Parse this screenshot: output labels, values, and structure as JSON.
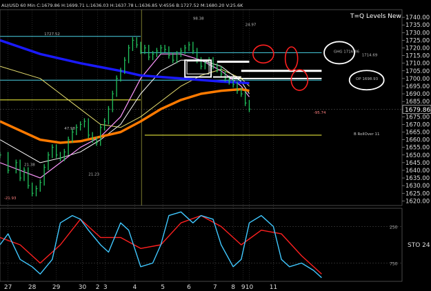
{
  "header": "AU/USD 60 Min  C:1679.86  H:1699.71  L:1636.03  H:1637.78  L:1636.85  V:4556  B:1727.52  M:1680.20  V:25.6K",
  "chart_data": {
    "type": "line",
    "title": "T=Q Levels New",
    "instrument": "AU/USD 60 Min",
    "ylim": [
      1617,
      1745
    ],
    "y_ticks": [
      1620,
      1625,
      1630,
      1635,
      1640,
      1645,
      1650,
      1655,
      1660,
      1665,
      1670,
      1675,
      1680,
      1685,
      1690,
      1695,
      1700,
      1705,
      1710,
      1715,
      1720,
      1725,
      1730,
      1735,
      1740
    ],
    "x_ticks": [
      {
        "label": "27",
        "pos": 0.02
      },
      {
        "label": "28",
        "pos": 0.08
      },
      {
        "label": "29",
        "pos": 0.14
      },
      {
        "label": "30",
        "pos": 0.205
      },
      {
        "label": "2",
        "pos": 0.243
      },
      {
        "label": "3",
        "pos": 0.262
      },
      {
        "label": "4",
        "pos": 0.335
      },
      {
        "label": "5",
        "pos": 0.405
      },
      {
        "label": "6",
        "pos": 0.47
      },
      {
        "label": "7",
        "pos": 0.535
      },
      {
        "label": "8",
        "pos": 0.58
      },
      {
        "label": "9",
        "pos": 0.605
      },
      {
        "label": "10",
        "pos": 0.62
      },
      {
        "label": "11",
        "pos": 0.68
      }
    ],
    "last_price": 1679.86,
    "colors": {
      "price": "#22c55e",
      "blue_ma": "#1a1aff",
      "orange_ma": "#ff7a00",
      "yellow_ma": "#e8e070",
      "white_ma": "#ffffff",
      "pink_ma": "#ff99ff",
      "sto_k": "#40c8ff",
      "sto_d": "#ff2020",
      "level_cyan": "#4ad3e6",
      "level_yellow": "#ffff40"
    },
    "price": {
      "x": [
        0,
        0.02,
        0.04,
        0.05,
        0.06,
        0.07,
        0.08,
        0.09,
        0.1,
        0.11,
        0.12,
        0.13,
        0.14,
        0.15,
        0.16,
        0.17,
        0.18,
        0.19,
        0.2,
        0.21,
        0.22,
        0.23,
        0.24,
        0.25,
        0.26,
        0.27,
        0.28,
        0.29,
        0.3,
        0.31,
        0.32,
        0.33,
        0.34,
        0.35,
        0.36,
        0.37,
        0.38,
        0.39,
        0.4,
        0.41,
        0.42,
        0.43,
        0.44,
        0.45,
        0.46,
        0.47,
        0.48,
        0.49,
        0.5,
        0.51,
        0.52,
        0.53,
        0.54,
        0.55,
        0.56,
        0.57,
        0.58,
        0.59,
        0.6,
        0.61,
        0.62
      ],
      "values": [
        1650,
        1640,
        1645,
        1635,
        1640,
        1630,
        1625,
        1628,
        1632,
        1642,
        1650,
        1655,
        1650,
        1648,
        1652,
        1660,
        1665,
        1668,
        1670,
        1672,
        1663,
        1660,
        1658,
        1668,
        1672,
        1680,
        1690,
        1700,
        1705,
        1712,
        1720,
        1725,
        1722,
        1718,
        1720,
        1714,
        1716,
        1718,
        1720,
        1719,
        1715,
        1712,
        1716,
        1718,
        1720,
        1722,
        1718,
        1712,
        1708,
        1710,
        1712,
        1708,
        1706,
        1703,
        1700,
        1698,
        1696,
        1692,
        1690,
        1684,
        1680
      ]
    },
    "blue_ma": {
      "x": [
        0,
        0.1,
        0.2,
        0.3,
        0.35,
        0.45,
        0.55,
        0.62
      ],
      "values": [
        1725,
        1716,
        1710,
        1705,
        1702,
        1700,
        1698,
        1697
      ]
    },
    "orange_ma": {
      "x": [
        0,
        0.1,
        0.15,
        0.2,
        0.25,
        0.3,
        0.35,
        0.4,
        0.45,
        0.5,
        0.55,
        0.6,
        0.62
      ],
      "values": [
        1672,
        1660,
        1658,
        1659,
        1662,
        1665,
        1672,
        1680,
        1686,
        1690,
        1692,
        1693,
        1692
      ]
    },
    "yellow_ma": {
      "x": [
        0,
        0.1,
        0.15,
        0.2,
        0.25,
        0.3,
        0.35,
        0.4,
        0.45,
        0.5,
        0.55,
        0.6,
        0.62
      ],
      "values": [
        1708,
        1700,
        1690,
        1680,
        1670,
        1668,
        1675,
        1685,
        1695,
        1702,
        1706,
        1700,
        1695
      ]
    },
    "white_ma": {
      "x": [
        0,
        0.1,
        0.15,
        0.2,
        0.25,
        0.3,
        0.35,
        0.4,
        0.45,
        0.5,
        0.55,
        0.6,
        0.62
      ],
      "values": [
        1660,
        1645,
        1648,
        1652,
        1660,
        1670,
        1690,
        1705,
        1712,
        1712,
        1708,
        1698,
        1690
      ]
    },
    "pink_ma": {
      "x": [
        0,
        0.05,
        0.1,
        0.15,
        0.2,
        0.25,
        0.3,
        0.35,
        0.4,
        0.45,
        0.5,
        0.55,
        0.6,
        0.62
      ],
      "values": [
        1645,
        1640,
        1635,
        1645,
        1655,
        1662,
        1675,
        1700,
        1716,
        1716,
        1712,
        1705,
        1695,
        1688
      ]
    },
    "levels": [
      {
        "value": 1727.52,
        "color": "#4ad3e6",
        "x0": 0,
        "x1": 0.35,
        "label": "1727.52"
      },
      {
        "value": 1716.86,
        "color": "#4ad3e6",
        "x0": 0.35,
        "x1": 0.8,
        "label": ""
      },
      {
        "value": 1700.0,
        "color": "#ffffff",
        "x0": 0.57,
        "x1": 0.8,
        "label": ""
      },
      {
        "value": 1698.93,
        "color": "#4ad3e6",
        "x0": 0.0,
        "x1": 0.8,
        "label": ""
      },
      {
        "value": 1686.0,
        "color": "#ffff40",
        "x0": 0,
        "x1": 0.35,
        "label": ""
      },
      {
        "value": 1663.0,
        "color": "#ffff40",
        "x0": 0.36,
        "x1": 0.8,
        "label": ""
      }
    ],
    "annotations": [
      {
        "text": "GHG 1716.86",
        "x": 0.83,
        "y": 1716.86,
        "color": "#bbbbbb"
      },
      {
        "text": "1714.69",
        "x": 0.9,
        "y": 1714.5,
        "color": "#bbbbbb"
      },
      {
        "text": "OP 1698.93",
        "x": 0.885,
        "y": 1698.93,
        "color": "#bbbbbb"
      },
      {
        "text": "B RollOver 11",
        "x": 0.88,
        "y": 1663,
        "color": "#cccccc"
      },
      {
        "text": "1727.52",
        "x": 0.11,
        "y": 1728.4,
        "color": "#bbbbbb"
      },
      {
        "text": "98.38",
        "x": 0.48,
        "y": 1738.5,
        "color": "#bbbbbb"
      },
      {
        "text": "24.97",
        "x": 0.61,
        "y": 1734.5,
        "color": "#bbbbbb"
      },
      {
        "text": "47.98",
        "x": 0.16,
        "y": 1666.5,
        "color": "#bbbbbb"
      },
      {
        "text": "21.38",
        "x": 0.06,
        "y": 1643.0,
        "color": "#bbbbbb"
      },
      {
        "text": "21.23",
        "x": 0.22,
        "y": 1636.5,
        "color": "#bbbbbb"
      },
      {
        "text": "-21.93",
        "x": 0.01,
        "y": 1621.0,
        "color": "#ff8080"
      },
      {
        "text": "-95.74",
        "x": 0.78,
        "y": 1677.0,
        "color": "#ff8080"
      }
    ],
    "sto": {
      "label": "STO 24",
      "ylim": [
        0,
        1000
      ],
      "ticks": [
        {
          "label": "250",
          "value": 750
        },
        {
          "label": "750",
          "value": 250
        }
      ],
      "k": {
        "x": [
          0,
          0.02,
          0.05,
          0.08,
          0.1,
          0.13,
          0.15,
          0.18,
          0.2,
          0.22,
          0.25,
          0.27,
          0.3,
          0.32,
          0.35,
          0.38,
          0.4,
          0.42,
          0.45,
          0.48,
          0.5,
          0.53,
          0.55,
          0.58,
          0.6,
          0.62,
          0.65,
          0.68,
          0.7,
          0.72,
          0.75,
          0.78,
          0.8
        ],
        "values": [
          500,
          650,
          300,
          200,
          100,
          300,
          800,
          900,
          850,
          700,
          500,
          400,
          800,
          700,
          200,
          250,
          500,
          900,
          950,
          800,
          900,
          850,
          500,
          200,
          300,
          800,
          900,
          750,
          300,
          200,
          250,
          150,
          50
        ]
      },
      "d": {
        "x": [
          0,
          0.05,
          0.1,
          0.15,
          0.2,
          0.25,
          0.3,
          0.35,
          0.4,
          0.45,
          0.5,
          0.55,
          0.6,
          0.65,
          0.7,
          0.75,
          0.8
        ],
        "values": [
          600,
          500,
          250,
          500,
          850,
          600,
          600,
          450,
          500,
          800,
          900,
          750,
          500,
          700,
          650,
          350,
          100
        ]
      }
    }
  }
}
